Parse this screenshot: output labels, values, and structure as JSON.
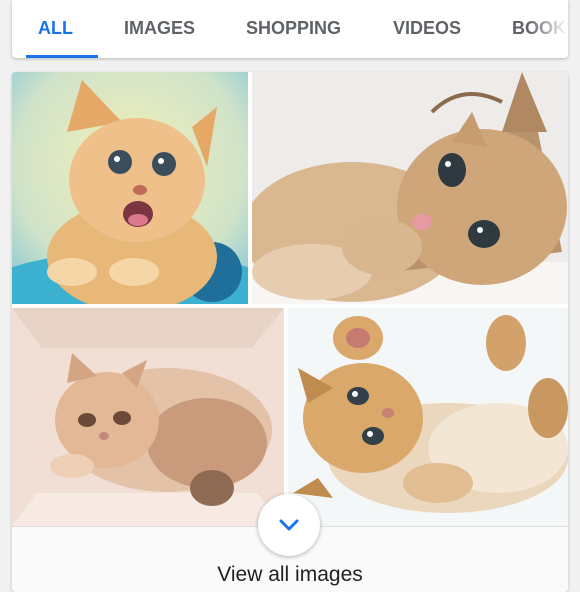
{
  "tabs": [
    {
      "label": "ALL",
      "active": true
    },
    {
      "label": "IMAGES",
      "active": false
    },
    {
      "label": "SHOPPING",
      "active": false
    },
    {
      "label": "VIDEOS",
      "active": false
    },
    {
      "label": "BOOK",
      "active": false
    }
  ],
  "images": [
    {
      "subject": "orange kitten with open mouth on blue background"
    },
    {
      "subject": "tabby kitten lying on its side licking paw"
    },
    {
      "subject": "cream kitten curled up in a box"
    },
    {
      "subject": "tabby kitten lying on its back with paws up"
    }
  ],
  "footer": {
    "view_all_label": "View all images",
    "expand_icon": "chevron-down-icon"
  },
  "colors": {
    "accent": "#1a73e8",
    "tab_text": "#5f6368"
  }
}
